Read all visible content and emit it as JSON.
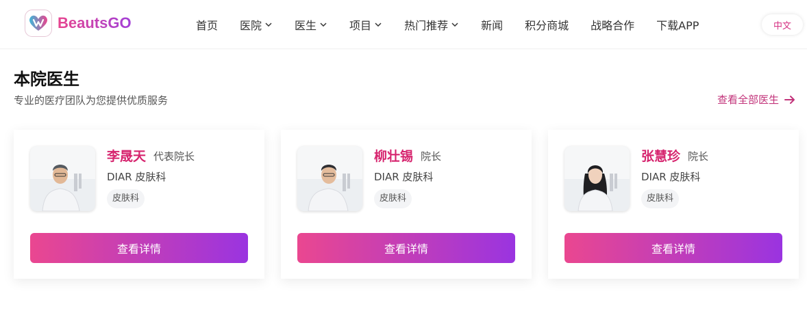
{
  "brand": {
    "name": "BeautsGO"
  },
  "nav": {
    "items": [
      {
        "label": "首页",
        "has_dropdown": false
      },
      {
        "label": "医院",
        "has_dropdown": true
      },
      {
        "label": "医生",
        "has_dropdown": true
      },
      {
        "label": "项目",
        "has_dropdown": true
      },
      {
        "label": "热门推荐",
        "has_dropdown": true
      },
      {
        "label": "新闻",
        "has_dropdown": false
      },
      {
        "label": "积分商城",
        "has_dropdown": false
      },
      {
        "label": "战略合作",
        "has_dropdown": false
      },
      {
        "label": "下载APP",
        "has_dropdown": false
      }
    ],
    "language": "中文"
  },
  "section": {
    "title": "本院医生",
    "subtitle": "专业的医疗团队为您提供优质服务",
    "view_all": "查看全部医生"
  },
  "doctors": [
    {
      "name": "李晟天",
      "title": "代表院长",
      "clinic": "DIAR 皮肤科",
      "tag": "皮肤科",
      "button": "查看详情"
    },
    {
      "name": "柳壮锡",
      "title": "院长",
      "clinic": "DIAR 皮肤科",
      "tag": "皮肤科",
      "button": "查看详情"
    },
    {
      "name": "张慧珍",
      "title": "院长",
      "clinic": "DIAR 皮肤科",
      "tag": "皮肤科",
      "button": "查看详情"
    }
  ],
  "colors": {
    "accent": "#d6246e",
    "button_gradient_start": "#ea4790",
    "button_gradient_end": "#9a34e0",
    "link": "#c2337a"
  }
}
